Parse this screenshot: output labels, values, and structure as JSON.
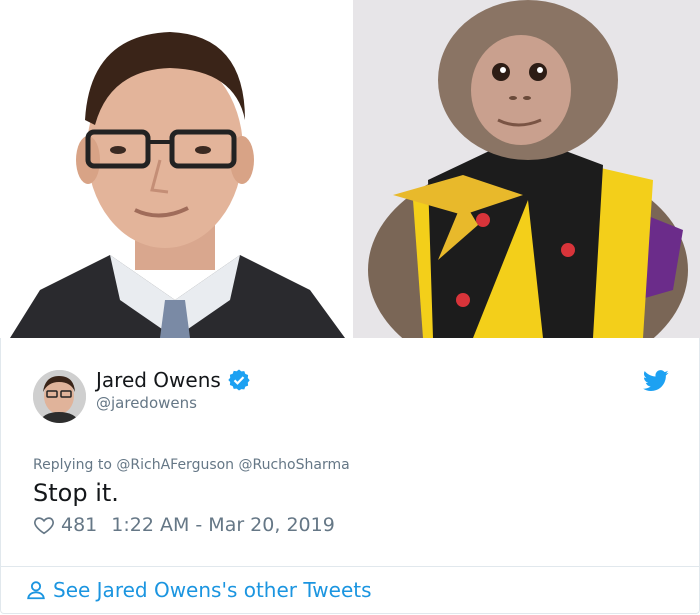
{
  "tweet": {
    "display_name": "Jared Owens",
    "handle": "@jaredowens",
    "replying_prefix": "Replying to",
    "reply_to_1": "@RichAFerguson",
    "reply_to_2": "@RuchoSharma",
    "text": "Stop it.",
    "likes": "481",
    "timestamp": "1:22 AM - Mar 20, 2019",
    "verified": true
  },
  "footer": {
    "label": "See Jared Owens's other Tweets"
  },
  "colors": {
    "twitter_blue": "#1da1f2",
    "link_blue": "#1b95e0",
    "muted_gray": "#657786",
    "text_dark": "#14171a",
    "border": "#e1e8ed"
  },
  "icons": [
    "verified-badge-icon",
    "twitter-bird-icon",
    "heart-icon",
    "person-icon"
  ]
}
